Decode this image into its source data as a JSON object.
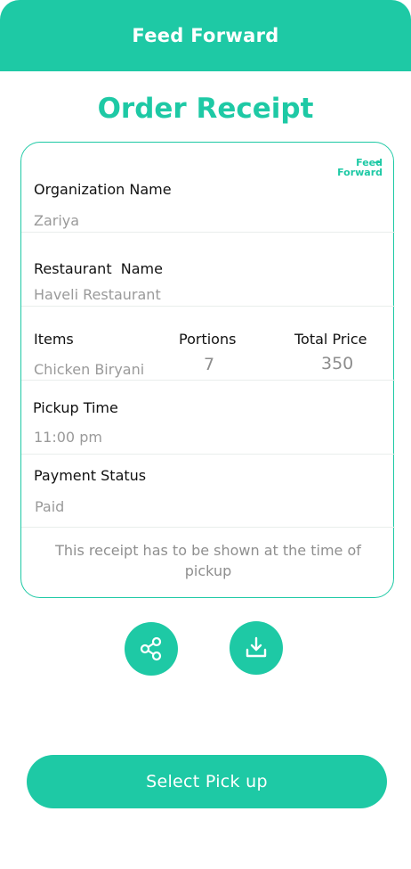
{
  "app": {
    "title": "Feed Forward"
  },
  "page": {
    "title": "Order Receipt"
  },
  "logo": {
    "line1": "Feed",
    "line2": "Forward"
  },
  "receipt": {
    "organization": {
      "label": "Organization Name",
      "value": "Zariya"
    },
    "restaurant": {
      "label": "Restaurant  Name",
      "value": "Haveli Restaurant"
    },
    "items": {
      "items_label": "Items",
      "portions_label": "Portions",
      "total_label": "Total Price",
      "item": "Chicken Biryani",
      "portions": "7",
      "total": "350"
    },
    "pickup_time": {
      "label": "Pickup Time",
      "value": "11:00 pm"
    },
    "payment": {
      "label": "Payment Status",
      "value": "Paid"
    },
    "note": "This receipt has to be shown at the time of pickup"
  },
  "actions": {
    "share_icon": "share-icon",
    "download_icon": "download-icon"
  },
  "cta": {
    "label": "Select Pick up"
  },
  "colors": {
    "accent": "#1ec9a5"
  }
}
